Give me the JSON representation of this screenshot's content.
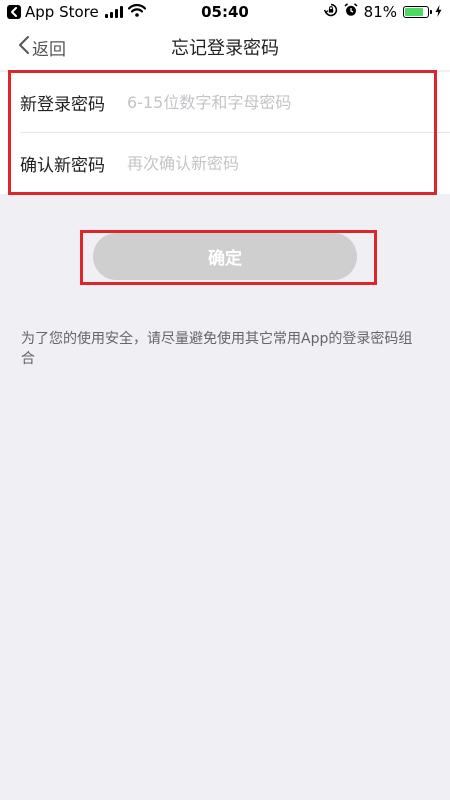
{
  "status_bar": {
    "back_app": "App Store",
    "time": "05:40",
    "battery_percent": "81%",
    "battery_level": 0.81,
    "battery_color": "#4cd964"
  },
  "nav": {
    "back_label": "返回",
    "title": "忘记登录密码"
  },
  "form": {
    "new_password": {
      "label": "新登录密码",
      "placeholder": "6-15位数字和字母密码",
      "value": ""
    },
    "confirm_password": {
      "label": "确认新密码",
      "placeholder": "再次确认新密码",
      "value": ""
    }
  },
  "confirm_button": {
    "label": "确定",
    "color": "#cfcfcf"
  },
  "hint": {
    "text": "为了您的使用安全，请尽量避免使用其它常用App的登录密码组合"
  },
  "highlight_color": "#e0242b"
}
